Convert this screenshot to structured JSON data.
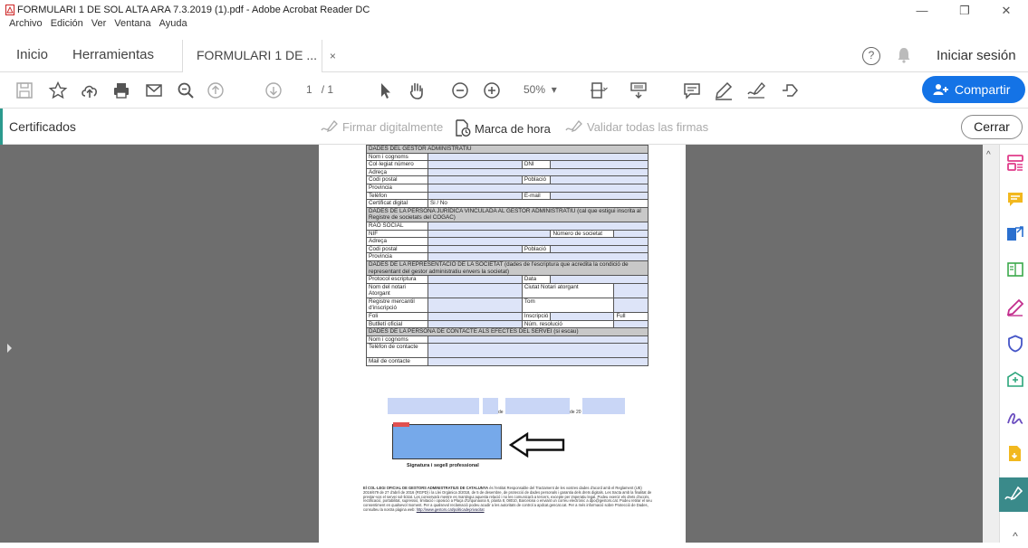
{
  "window": {
    "title": "FORMULARI 1 DE SOL ALTA ARA 7.3.2019 (1).pdf - Adobe Acrobat Reader DC",
    "menu": [
      "Archivo",
      "Edición",
      "Ver",
      "Ventana",
      "Ayuda"
    ],
    "controls": {
      "minimize": "—",
      "maximize": "❐",
      "close": "✕"
    }
  },
  "tabs": {
    "home": "Inicio",
    "tools": "Herramientas",
    "document": "FORMULARI 1 DE ...",
    "document_close": "×",
    "help": "?",
    "signin": "Iniciar sesión"
  },
  "toolbar": {
    "page": "1",
    "page_total": "/ 1",
    "zoom": "50%",
    "zoom_caret": "▾",
    "share": "Compartir"
  },
  "certbar": {
    "title": "Certificados",
    "sign_digitally": "Firmar digitalmente",
    "timestamp": "Marca de hora",
    "validate_all": "Validar todas las firmas",
    "close": "Cerrar"
  },
  "form": {
    "rows": [
      [
        "DADES DEL GESTOR ADMINISTRATIU"
      ],
      [
        "Nom i cognoms"
      ],
      [
        "Col·legiat número",
        "DNI"
      ],
      [
        "Adreça"
      ],
      [
        "Codi postal",
        "Població"
      ],
      [
        "Provincia"
      ],
      [
        "Telèfon",
        "E-mail"
      ],
      [
        "Certificat digital",
        "Si / No"
      ],
      [
        "DADES DE LA PERSONA JURÍDICA VINCULADA AL GESTOR ADMINISTRATIU (cal que estigui inscrita al Registre de societats del COGAC)"
      ],
      [
        "RAÓ SOCIAL"
      ],
      [
        "NIF",
        "Número de societat"
      ],
      [
        "Adreça"
      ],
      [
        "Codi postal",
        "Població"
      ],
      [
        "Provincia"
      ],
      [
        "DADES DE LA REPRESENTACIÓ DE LA SOCIETAT (dades de l'escriptura que acredita la condició de representant del gestor administratiu envers la societat)"
      ],
      [
        "Protocol escriptura",
        "Data"
      ],
      [
        "Nom del notari Atorgant",
        "Ciutat Notari atorgant"
      ],
      [
        "Registre mercantil d'inscripció",
        "Tom"
      ],
      [
        "Foli",
        "Inscripció",
        "Full"
      ],
      [
        "Butlletí oficial",
        "Núm. resolució"
      ],
      [
        "DADES DE LA PERSONA DE CONTACTE ALS EFECTES DEL SERVEI (si escau)"
      ],
      [
        "Nom i cognoms"
      ],
      [
        "Telèfon de contacte"
      ],
      [
        "Mail de contacte"
      ]
    ],
    "date_de1": "de",
    "date_de2": "de 20",
    "stamp_label": "Signatura i segell professional",
    "legal_bold": "El COL·LEGI OFICIAL DE GESTORS ADMINISTRATIUS DE CATALUNYA",
    "legal_text": " és l'entitat Responsable del Tractament de les vostres dades d'acord amb el Reglament (UE) 2016/679 de 27 d'abril de 2016 (RGPD) i la Llei Orgànica 3/2018, de 5 de desembre, de protecció de dades personals i garantia dels drets digitals. Les tracta amb la finalitat de prestar-vos el servei sol·licitat. Les conservarà mentre es mantingui aquesta relació i no les comunicarà a tercers, excepte per imperatiu legal. Podeu exercir els drets d'accés, rectificació, portabilitat, supressió, limitació i oposició a Plaça d'Urquinaona 6, planta 8, 08010, Barcelona o enviant un correu electrònic a dpo@gestors.cat. Podeu retirar el seu consentiment en qualsevol moment. Per a qualsevol reclamació podeu acudir a les autoritats de control a apdcat.gencat.cat. Per a més informació sobre Protecció de Dades, consulteu la nostra pàgina web: ",
    "legal_link": "http://www.gestors.cat/politicadeprivacitat"
  },
  "colors": {
    "accent_teal": "#2b9a8e",
    "share_blue": "#1473e6",
    "field_blue": "#dde4f8",
    "stamp_blue": "#76a9ea"
  }
}
